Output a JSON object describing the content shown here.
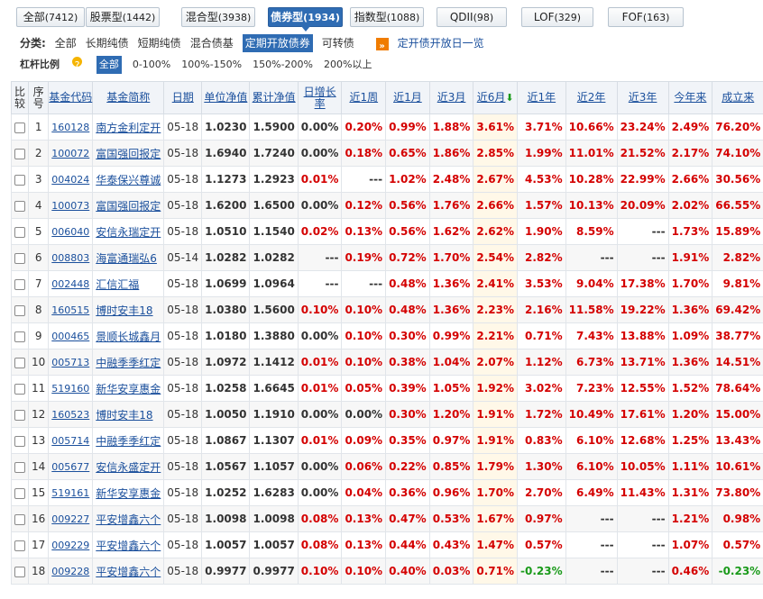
{
  "tabs": [
    {
      "label": "全部",
      "count": "(7412)"
    },
    {
      "label": "股票型",
      "count": "(1442)"
    },
    {
      "label": "混合型",
      "count": "(3938)"
    },
    {
      "label": "债券型",
      "count": "(1934)"
    },
    {
      "label": "指数型",
      "count": "(1088)"
    },
    {
      "label": "QDII",
      "count": "(98)"
    },
    {
      "label": "LOF",
      "count": "(329)"
    },
    {
      "label": "FOF",
      "count": "(163)"
    }
  ],
  "active_tab": "债券型",
  "category": {
    "label": "分类:",
    "items": [
      "全部",
      "长期纯债",
      "短期纯债",
      "混合债基",
      "定期开放债券",
      "可转债"
    ],
    "active": "定期开放债券",
    "link_icon": "double-arrow-icon",
    "link": "定开债开放日一览"
  },
  "leverage": {
    "label": "杠杆比例",
    "info_icon": "info-icon",
    "items": [
      "全部",
      "0-100%",
      "100%-150%",
      "150%-200%",
      "200%以上"
    ],
    "active": "全部"
  },
  "table": {
    "headers": [
      "比较",
      "序号",
      "基金代码",
      "基金简称",
      "日期",
      "单位净值",
      "累计净值",
      "日增长率",
      "近1周",
      "近1月",
      "近3月",
      "近6月",
      "近1年",
      "近2年",
      "近3年",
      "今年来",
      "成立来"
    ],
    "sort_icon": "arrow-down-icon",
    "rows": [
      [
        "1",
        "160128",
        "南方金利定开",
        "05-18",
        "1.0230",
        "1.5900",
        "0.00%",
        "0.20%",
        "0.99%",
        "1.88%",
        "3.61%",
        "3.71%",
        "10.66%",
        "23.24%",
        "2.49%",
        "76.20%"
      ],
      [
        "2",
        "100072",
        "富国强回报定",
        "05-18",
        "1.6940",
        "1.7240",
        "0.00%",
        "0.18%",
        "0.65%",
        "1.86%",
        "2.85%",
        "1.99%",
        "11.01%",
        "21.52%",
        "2.17%",
        "74.10%"
      ],
      [
        "3",
        "004024",
        "华泰保兴尊诚",
        "05-18",
        "1.1273",
        "1.2923",
        "0.01%",
        "---",
        "1.02%",
        "2.48%",
        "2.67%",
        "4.53%",
        "10.28%",
        "22.99%",
        "2.66%",
        "30.56%"
      ],
      [
        "4",
        "100073",
        "富国强回报定",
        "05-18",
        "1.6200",
        "1.6500",
        "0.00%",
        "0.12%",
        "0.56%",
        "1.76%",
        "2.66%",
        "1.57%",
        "10.13%",
        "20.09%",
        "2.02%",
        "66.55%"
      ],
      [
        "5",
        "006040",
        "安信永瑞定开",
        "05-18",
        "1.0510",
        "1.1540",
        "0.02%",
        "0.13%",
        "0.56%",
        "1.62%",
        "2.62%",
        "1.90%",
        "8.59%",
        "---",
        "1.73%",
        "15.89%"
      ],
      [
        "6",
        "008803",
        "海富通瑞弘6",
        "05-14",
        "1.0282",
        "1.0282",
        "---",
        "0.19%",
        "0.72%",
        "1.70%",
        "2.54%",
        "2.82%",
        "---",
        "---",
        "1.91%",
        "2.82%"
      ],
      [
        "7",
        "002448",
        "汇信汇福",
        "05-18",
        "1.0699",
        "1.0964",
        "---",
        "---",
        "0.48%",
        "1.36%",
        "2.41%",
        "3.53%",
        "9.04%",
        "17.38%",
        "1.70%",
        "9.81%"
      ],
      [
        "8",
        "160515",
        "博时安丰18",
        "05-18",
        "1.0380",
        "1.5600",
        "0.10%",
        "0.10%",
        "0.48%",
        "1.36%",
        "2.23%",
        "2.16%",
        "11.58%",
        "19.22%",
        "1.36%",
        "69.42%"
      ],
      [
        "9",
        "000465",
        "景顺长城鑫月",
        "05-18",
        "1.0180",
        "1.3880",
        "0.00%",
        "0.10%",
        "0.30%",
        "0.99%",
        "2.21%",
        "0.71%",
        "7.43%",
        "13.88%",
        "1.09%",
        "38.77%"
      ],
      [
        "10",
        "005713",
        "中融季季红定",
        "05-18",
        "1.0972",
        "1.1412",
        "0.01%",
        "0.10%",
        "0.38%",
        "1.04%",
        "2.07%",
        "1.12%",
        "6.73%",
        "13.71%",
        "1.36%",
        "14.51%"
      ],
      [
        "11",
        "519160",
        "新华安享惠金",
        "05-18",
        "1.0258",
        "1.6645",
        "0.01%",
        "0.05%",
        "0.39%",
        "1.05%",
        "1.92%",
        "3.02%",
        "7.23%",
        "12.55%",
        "1.52%",
        "78.64%"
      ],
      [
        "12",
        "160523",
        "博时安丰18",
        "05-18",
        "1.0050",
        "1.1910",
        "0.00%",
        "0.00%",
        "0.30%",
        "1.20%",
        "1.91%",
        "1.72%",
        "10.49%",
        "17.61%",
        "1.20%",
        "15.00%"
      ],
      [
        "13",
        "005714",
        "中融季季红定",
        "05-18",
        "1.0867",
        "1.1307",
        "0.01%",
        "0.09%",
        "0.35%",
        "0.97%",
        "1.91%",
        "0.83%",
        "6.10%",
        "12.68%",
        "1.25%",
        "13.43%"
      ],
      [
        "14",
        "005677",
        "安信永盛定开",
        "05-18",
        "1.0567",
        "1.1057",
        "0.00%",
        "0.06%",
        "0.22%",
        "0.85%",
        "1.79%",
        "1.30%",
        "6.10%",
        "10.05%",
        "1.11%",
        "10.61%"
      ],
      [
        "15",
        "519161",
        "新华安享惠金",
        "05-18",
        "1.0252",
        "1.6283",
        "0.00%",
        "0.04%",
        "0.36%",
        "0.96%",
        "1.70%",
        "2.70%",
        "6.49%",
        "11.43%",
        "1.31%",
        "73.80%"
      ],
      [
        "16",
        "009227",
        "平安增鑫六个",
        "05-18",
        "1.0098",
        "1.0098",
        "0.08%",
        "0.13%",
        "0.47%",
        "0.53%",
        "1.67%",
        "0.97%",
        "---",
        "---",
        "1.21%",
        "0.98%"
      ],
      [
        "17",
        "009229",
        "平安增鑫六个",
        "05-18",
        "1.0057",
        "1.0057",
        "0.08%",
        "0.13%",
        "0.44%",
        "0.43%",
        "1.47%",
        "0.57%",
        "---",
        "---",
        "1.07%",
        "0.57%"
      ],
      [
        "18",
        "009228",
        "平安增鑫六个",
        "05-18",
        "0.9977",
        "0.9977",
        "0.10%",
        "0.10%",
        "0.40%",
        "0.03%",
        "0.71%",
        "-0.23%",
        "---",
        "---",
        "0.46%",
        "-0.23%"
      ]
    ]
  },
  "colors": {
    "accent": "#2f6cb3",
    "up": "#d40000",
    "down": "#1a9a1a",
    "link": "#1a4f9c"
  }
}
